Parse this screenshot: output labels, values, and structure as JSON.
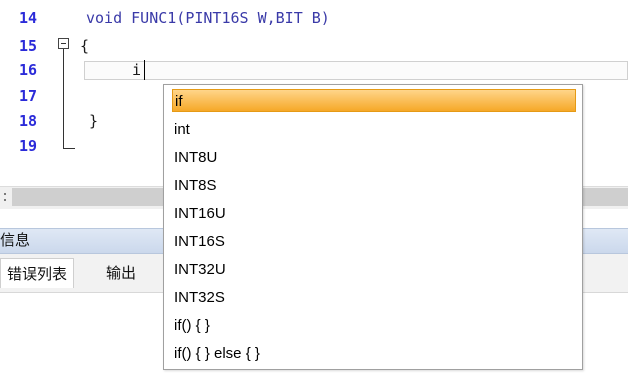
{
  "editor": {
    "lines": [
      {
        "num": "14",
        "text": "void FUNC1(PINT16S W,BIT B)"
      },
      {
        "num": "15",
        "text": "{"
      },
      {
        "num": "16",
        "text": "i"
      },
      {
        "num": "17",
        "text": ""
      },
      {
        "num": "18",
        "text": "}"
      },
      {
        "num": "19",
        "text": ""
      }
    ]
  },
  "bottom_panel": {
    "title": "信息",
    "tabs": [
      {
        "label": "错误列表"
      },
      {
        "label": "输出"
      }
    ]
  },
  "autocomplete": {
    "selected_index": 0,
    "items": [
      "if",
      "int",
      "INT8U",
      "INT8S",
      "INT16U",
      "INT16S",
      "INT32U",
      "INT32S",
      "if() { }",
      "if() { } else { }"
    ]
  },
  "colors": {
    "line_numbers": "#2b2bd9",
    "selection_top": "#ffd58a",
    "selection_bottom": "#f6a828",
    "panel_title_bg": "#dfe8f5"
  }
}
